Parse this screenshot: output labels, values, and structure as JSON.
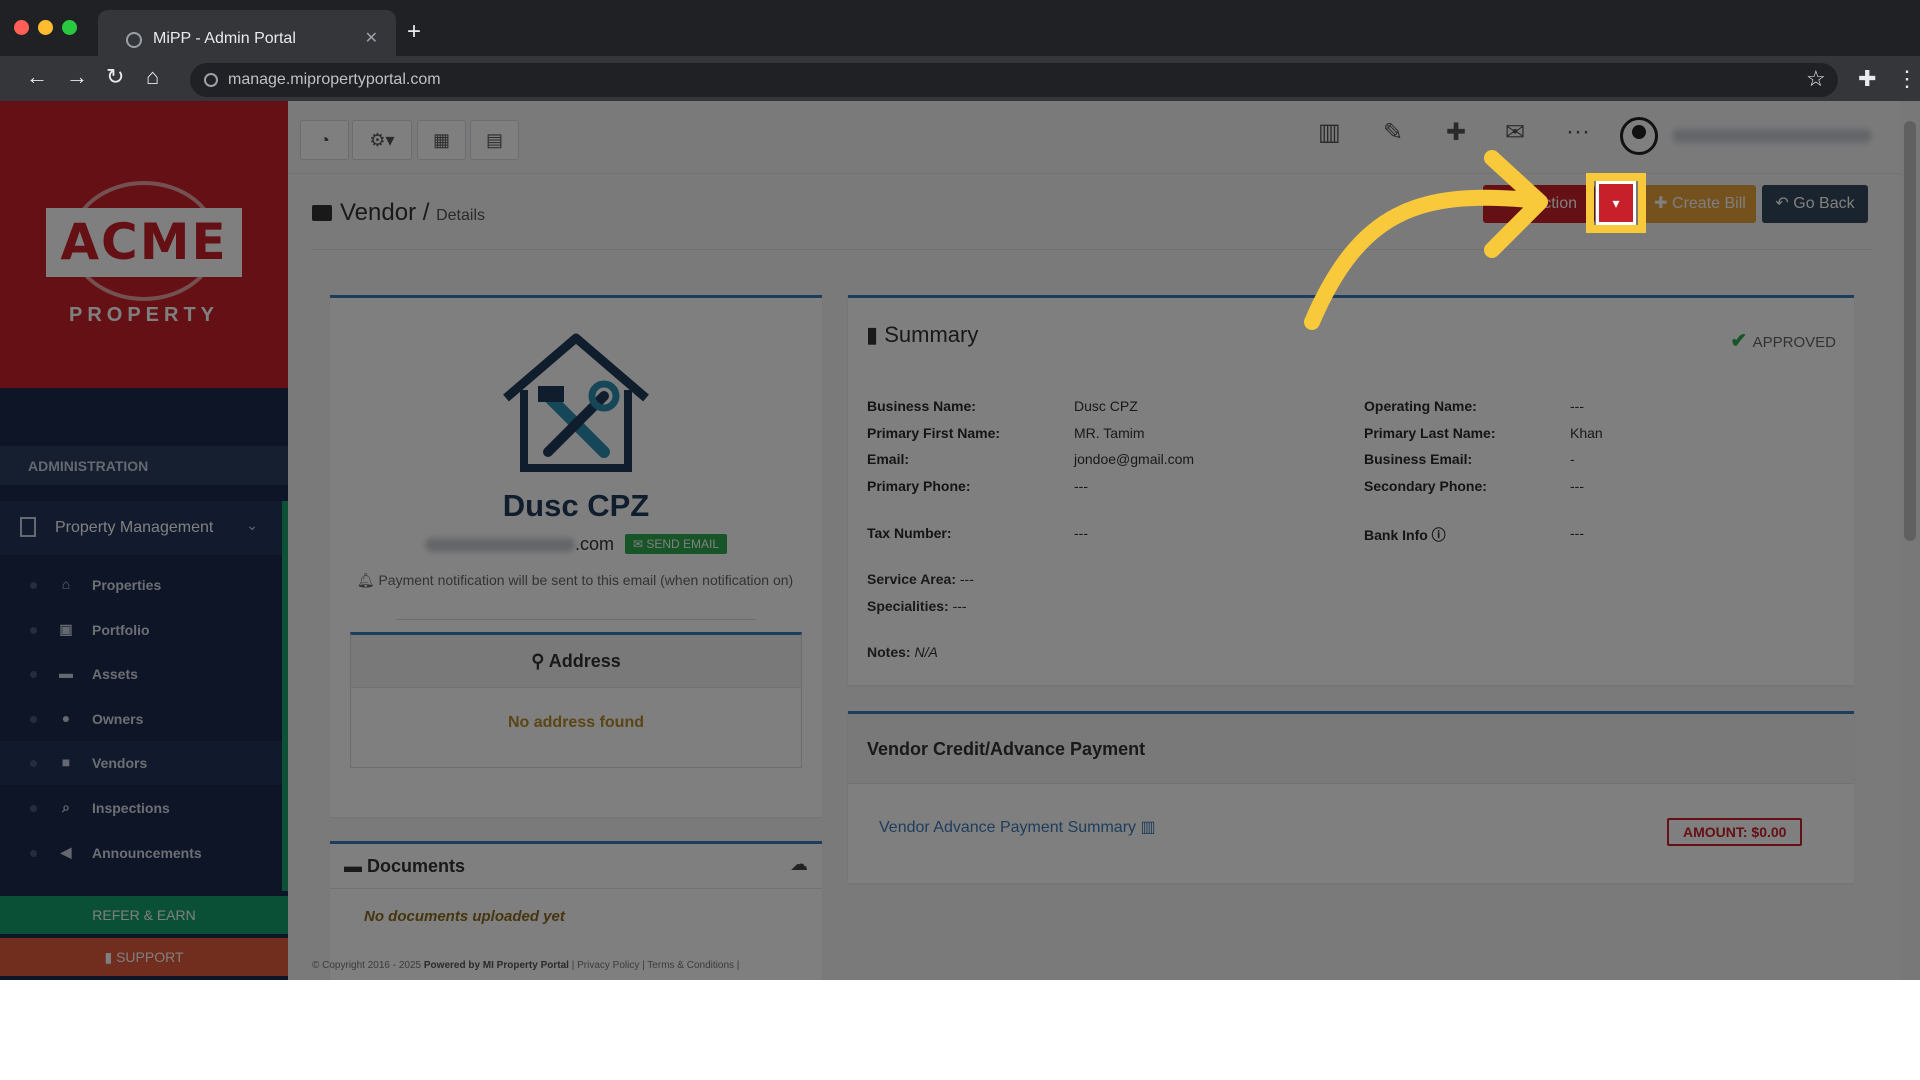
{
  "browser": {
    "tab_title": "MiPP - Admin Portal",
    "url": "manage.mipropertyportal.com"
  },
  "sidebar": {
    "logo_text": "ACME",
    "logo_sub": "PROPERTY",
    "section_label": "ADMINISTRATION",
    "group_label": "Property Management",
    "items": [
      {
        "label": "Properties",
        "icon": "home-icon"
      },
      {
        "label": "Portfolio",
        "icon": "portfolio-icon"
      },
      {
        "label": "Assets",
        "icon": "assets-icon"
      },
      {
        "label": "Owners",
        "icon": "user-icon"
      },
      {
        "label": "Vendors",
        "icon": "briefcase-icon"
      },
      {
        "label": "Inspections",
        "icon": "search-icon"
      },
      {
        "label": "Announcements",
        "icon": "megaphone-icon"
      }
    ],
    "refer_label": "REFER & EARN",
    "support_label": "SUPPORT"
  },
  "header": {
    "title": "Vendor",
    "separator": "/",
    "subtitle": "Details",
    "action_label": "Action",
    "create_bill_label": "Create Bill",
    "go_back_label": "Go Back"
  },
  "vendor": {
    "name": "Dusc CPZ",
    "email_suffix": ".com",
    "send_email_label": "SEND EMAIL",
    "notice": "Payment notification will be sent to this email (when notification on)",
    "address_title": "Address",
    "address_empty": "No address found",
    "documents_title": "Documents",
    "documents_empty": "No documents uploaded yet"
  },
  "summary": {
    "title": "Summary",
    "status": "APPROVED",
    "fields": {
      "business_name_label": "Business Name:",
      "business_name": "Dusc CPZ",
      "operating_name_label": "Operating Name:",
      "operating_name": "---",
      "first_name_label": "Primary First Name:",
      "first_name": "MR. Tamim",
      "last_name_label": "Primary Last Name:",
      "last_name": "Khan",
      "email_label": "Email:",
      "email": "jondoe@gmail.com",
      "business_email_label": "Business Email:",
      "business_email": "-",
      "primary_phone_label": "Primary Phone:",
      "primary_phone": "---",
      "secondary_phone_label": "Secondary Phone:",
      "secondary_phone": "---",
      "tax_number_label": "Tax Number:",
      "tax_number": "---",
      "bank_info_label": "Bank Info",
      "bank_info": "---",
      "service_area_label": "Service Area:",
      "service_area": "---",
      "specialities_label": "Specialities:",
      "specialities": "---",
      "notes_label": "Notes:",
      "notes": "N/A"
    }
  },
  "credit": {
    "title": "Vendor Credit/Advance Payment",
    "link_label": "Vendor Advance Payment Summary",
    "amount_label": "AMOUNT: $0.00"
  },
  "footer": {
    "copyright": "© Copyright 2016 - 2025",
    "powered": "Powered by MI Property Portal",
    "links": "| Privacy Policy | Terms & Conditions |"
  },
  "colors": {
    "sidebar_bg": "#1b2a4e",
    "logo_red": "#c8202a",
    "accent_blue": "#3c7ab8",
    "highlight_yellow": "#f9c93c",
    "approved_green": "#2fa84f",
    "create_bill_orange": "#e8a33a"
  }
}
